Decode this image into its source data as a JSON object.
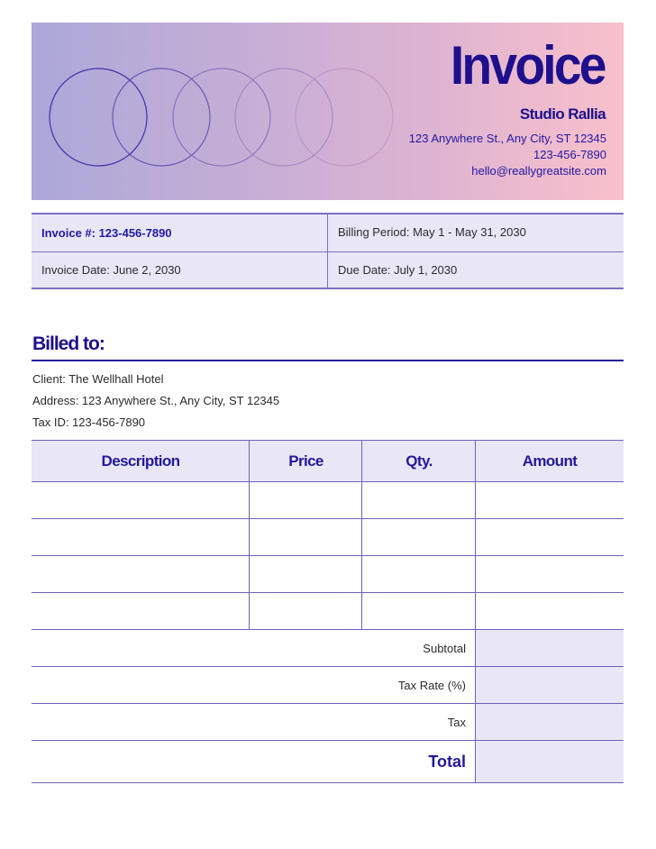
{
  "header": {
    "title": "Invoice",
    "company": "Studio Rallia",
    "address": "123 Anywhere St., Any City, ST 12345",
    "phone": "123-456-7890",
    "email": "hello@reallygreatsite.com",
    "gradient_colors": [
      "#aca8d8",
      "#f9c0cb"
    ],
    "decoration": "five-overlapping-circles"
  },
  "info": {
    "invoice_number": "Invoice #: 123-456-7890",
    "billing_period": "Billing Period: May 1 - May 31, 2030",
    "invoice_date": "Invoice Date: June 2, 2030",
    "due_date": "Due Date: July 1, 2030"
  },
  "billed_to": {
    "title": "Billed to:",
    "client": "Client: The Wellhall Hotel",
    "address": "Address: 123 Anywhere St., Any City, ST 12345",
    "tax_id": "Tax ID: 123-456-7890"
  },
  "items_table": {
    "columns": [
      "Description",
      "Price",
      "Qty.",
      "Amount"
    ],
    "rows": [
      {
        "description": "",
        "price": "",
        "qty": "",
        "amount": ""
      },
      {
        "description": "",
        "price": "",
        "qty": "",
        "amount": ""
      },
      {
        "description": "",
        "price": "",
        "qty": "",
        "amount": ""
      },
      {
        "description": "",
        "price": "",
        "qty": "",
        "amount": ""
      }
    ]
  },
  "summary": {
    "subtotal_label": "Subtotal",
    "tax_rate_label": "Tax Rate (%)",
    "tax_label": "Tax",
    "total_label": "Total",
    "subtotal_value": "",
    "tax_rate_value": "",
    "tax_value": "",
    "total_value": ""
  },
  "colors": {
    "primary": "#1e0f8c",
    "line": "#6b63b5",
    "panel": "#e9e6f6"
  }
}
